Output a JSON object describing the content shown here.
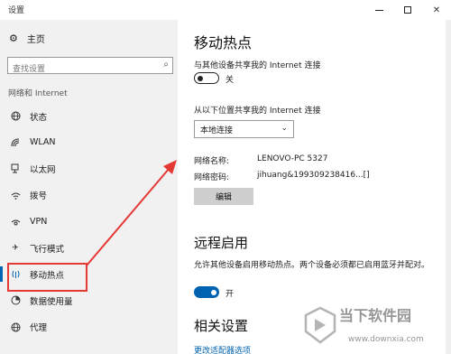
{
  "window": {
    "title": "设置",
    "minimize_icon": "minimize-icon",
    "maximize_icon": "maximize-icon",
    "close_icon": "close-icon"
  },
  "sidebar": {
    "home_label": "主页",
    "home_icon": "gear-icon",
    "search_placeholder": "查找设置",
    "search_icon": "search-icon",
    "section_label": "网络和 Internet",
    "items": [
      {
        "label": "状态",
        "icon": "globe-status-icon"
      },
      {
        "label": "WLAN",
        "icon": "wifi-icon"
      },
      {
        "label": "以太网",
        "icon": "ethernet-icon"
      },
      {
        "label": "拨号",
        "icon": "dialup-icon"
      },
      {
        "label": "VPN",
        "icon": "vpn-icon"
      },
      {
        "label": "飞行模式",
        "icon": "airplane-icon"
      },
      {
        "label": "移动热点",
        "icon": "hotspot-icon",
        "selected": true
      },
      {
        "label": "数据使用量",
        "icon": "data-usage-icon"
      },
      {
        "label": "代理",
        "icon": "globe-proxy-icon"
      }
    ],
    "accent_color": "#0063b1"
  },
  "main": {
    "title": "移动热点",
    "share_label": "与其他设备共享我的 Internet 连接",
    "share_toggle_state": "关",
    "share_from_label": "从以下位置共享我的 Internet 连接",
    "share_from_value": "本地连接",
    "network_name_label": "网络名称:",
    "network_name_value": "LENOVO-PC 5327",
    "network_password_label": "网络密码:",
    "network_password_value": "jihuang&199309238416...[]",
    "edit_button": "编辑",
    "remote_title": "远程启用",
    "remote_desc": "允许其他设备启用移动热点。两个设备必须都已启用蓝牙并配对。",
    "remote_toggle_state": "开",
    "related_title": "相关设置",
    "related_link": "更改适配器选项"
  },
  "annotation": {
    "highlight_color": "#e53935"
  },
  "watermark": {
    "title": "当下软件园",
    "url": "www.downxia.com"
  }
}
